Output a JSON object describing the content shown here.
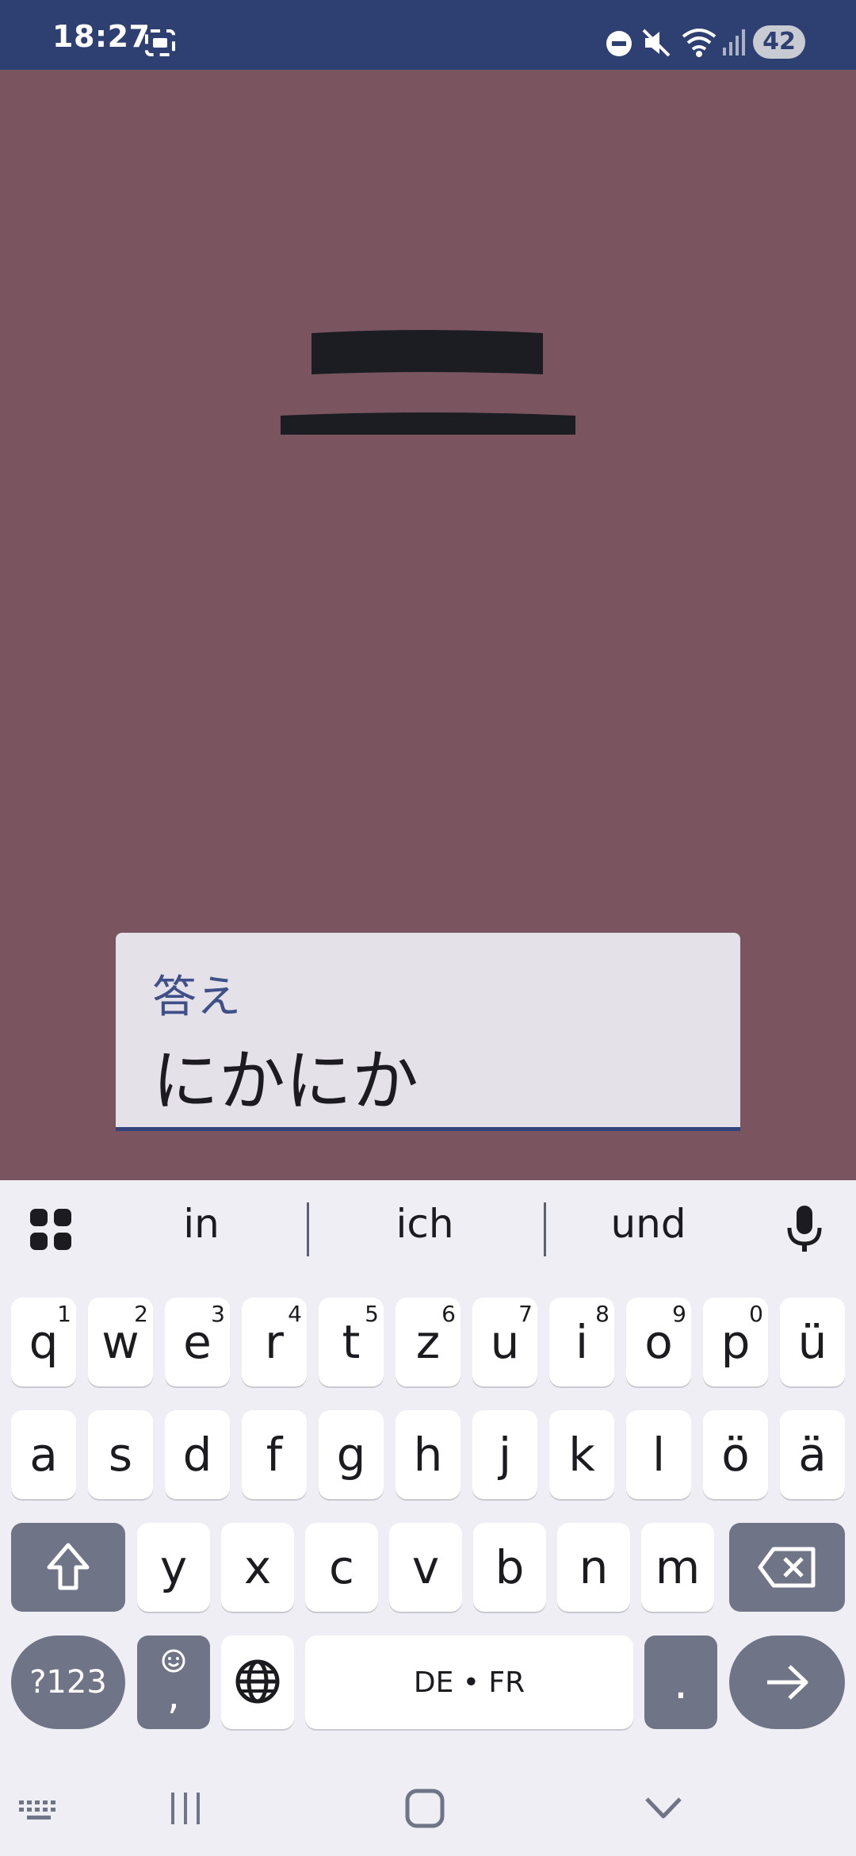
{
  "status": {
    "time": "18:27",
    "battery": "42",
    "icons": [
      "screenshot-icon",
      "dnd-icon",
      "mute-icon",
      "wifi-icon",
      "signal-icon"
    ]
  },
  "card": {
    "character": "二",
    "answer_label": "答え",
    "answer_value": "にかにか"
  },
  "keyboard": {
    "suggestions": [
      "in",
      "ich",
      "und"
    ],
    "row1": [
      {
        "ch": "q",
        "num": "1"
      },
      {
        "ch": "w",
        "num": "2"
      },
      {
        "ch": "e",
        "num": "3"
      },
      {
        "ch": "r",
        "num": "4"
      },
      {
        "ch": "t",
        "num": "5"
      },
      {
        "ch": "z",
        "num": "6"
      },
      {
        "ch": "u",
        "num": "7"
      },
      {
        "ch": "i",
        "num": "8"
      },
      {
        "ch": "o",
        "num": "9"
      },
      {
        "ch": "p",
        "num": "0"
      },
      {
        "ch": "ü",
        "num": ""
      }
    ],
    "row2": [
      "a",
      "s",
      "d",
      "f",
      "g",
      "h",
      "j",
      "k",
      "l",
      "ö",
      "ä"
    ],
    "row3": [
      "y",
      "x",
      "c",
      "v",
      "b",
      "n",
      "m"
    ],
    "symbols_label": "?123",
    "comma_label": ",",
    "space_label": "DE • FR",
    "period_label": "."
  },
  "colors": {
    "status_bar": "#2E3F72",
    "background": "#7A5560",
    "answer_accent": "#3F5088"
  }
}
